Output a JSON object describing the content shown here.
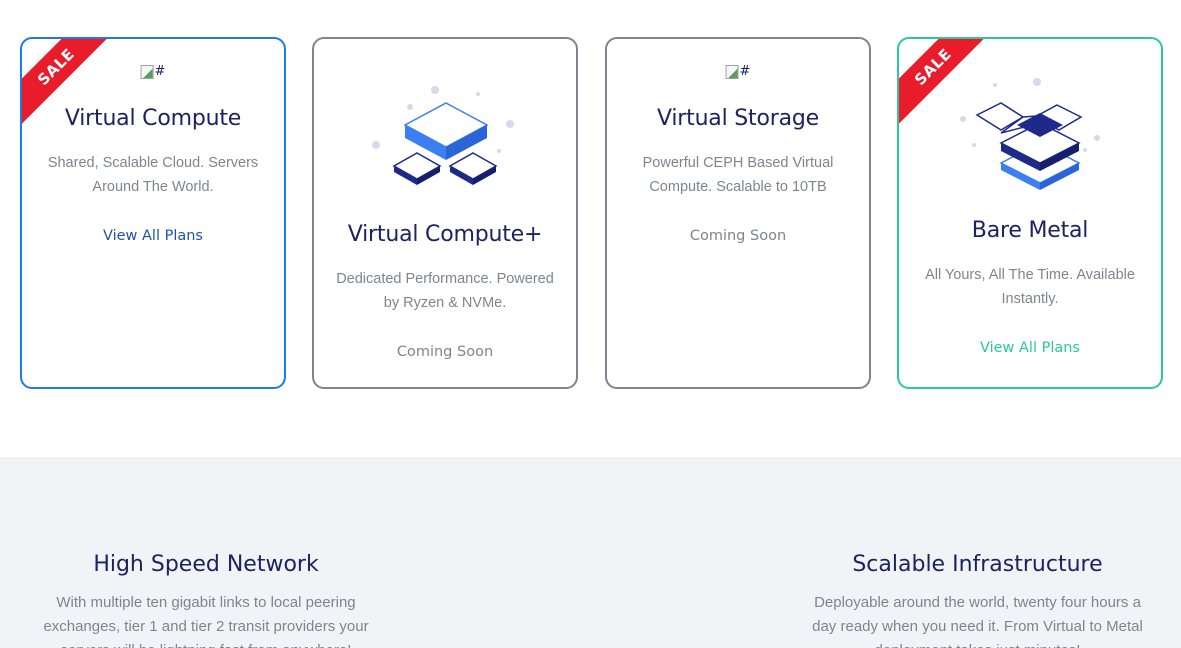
{
  "cards": [
    {
      "title": "Virtual Compute",
      "description": "Shared, Scalable Cloud. Servers Around The World.",
      "link": "View All Plans",
      "ribbon": "SALE",
      "image_alt": "#"
    },
    {
      "title": "Virtual Compute+",
      "description": "Dedicated Performance. Powered by Ryzen & NVMe.",
      "link": "Coming Soon"
    },
    {
      "title": "Virtual Storage",
      "description": "Powerful CEPH Based Virtual Compute. Scalable to 10TB",
      "link": "Coming Soon",
      "image_alt": "#"
    },
    {
      "title": "Bare Metal",
      "description": "All Yours, All The Time. Available Instantly.",
      "link": "View All Plans",
      "ribbon": "SALE"
    }
  ],
  "features": [
    {
      "title": "High Speed Network",
      "description": "With multiple ten gigabit links to local peering exchanges, tier 1 and tier 2 transit providers your servers will be lightning fast from anywhere!"
    },
    {
      "title": "Scalable Infrastructure",
      "description": "Deployable around the world, twenty four hours a day ready when you need it. From Virtual to Metal deployment takes just minutes!"
    }
  ],
  "colors": {
    "primary_blue": "#1f7ae6",
    "teal": "#2bc99a",
    "ribbon_red": "#e81c2a",
    "navy": "#1b2361",
    "muted_text": "#7d8590",
    "section_bg": "#f1f3f6"
  }
}
